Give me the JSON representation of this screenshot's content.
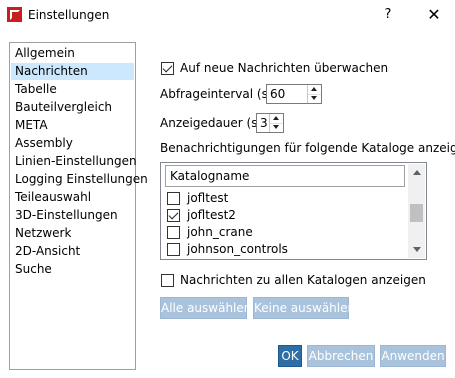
{
  "window": {
    "title": "Einstellungen",
    "help": "?",
    "close": "✕"
  },
  "nav": {
    "items": [
      "Allgemein",
      "Nachrichten",
      "Tabelle",
      "Bauteilvergleich",
      "META",
      "Assembly",
      "Linien-Einstellungen",
      "Logging Einstellungen",
      "Teileauswahl",
      "3D-Einstellungen",
      "Netzwerk",
      "2D-Ansicht",
      "Suche"
    ],
    "selected": "Nachrichten"
  },
  "settings": {
    "monitor_label": "Auf neue Nachrichten überwachen",
    "monitor_checked": true,
    "interval_label": "Abfrageinterval (s):",
    "interval_value": "60",
    "duration_label": "Anzeigedauer (s):",
    "duration_value": "3",
    "catalogs_label": "Benachrichtigungen für folgende Kataloge anzeige",
    "catalog_header": "Katalogname",
    "catalogs": [
      {
        "name": "jofltest",
        "checked": false
      },
      {
        "name": "jofltest2",
        "checked": true
      },
      {
        "name": "john_crane",
        "checked": false
      },
      {
        "name": "johnson_controls",
        "checked": false
      }
    ],
    "all_catalogs_label": "Nachrichten zu allen Katalogen anzeigen",
    "all_catalogs_checked": false
  },
  "buttons": {
    "select_all": "Alle auswählen",
    "select_none": "Keine auswählen",
    "ok": "OK",
    "cancel": "Abbrechen",
    "apply": "Anwenden"
  },
  "colors": {
    "selection": "#cce8ff",
    "primary_button": "#2e6ea6",
    "disabled_button": "#a9c3dc",
    "app_icon": "#c81e1e"
  }
}
